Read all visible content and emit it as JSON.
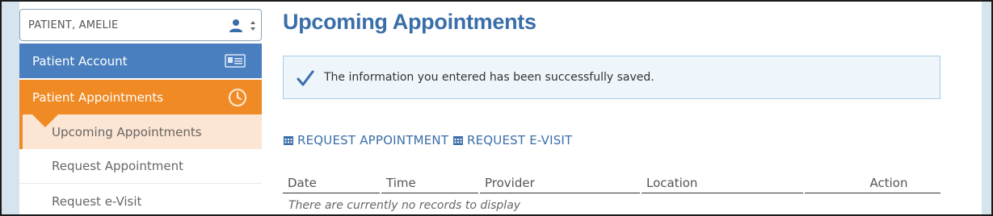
{
  "patient_selector": {
    "name": "PATIENT, AMELIE"
  },
  "sidebar": {
    "account": {
      "label": "Patient Account"
    },
    "appointments": {
      "label": "Patient Appointments"
    },
    "sub_items": [
      {
        "label": "Upcoming Appointments",
        "active": true
      },
      {
        "label": "Request Appointment"
      },
      {
        "label": "Request e-Visit"
      }
    ]
  },
  "main": {
    "title": "Upcoming Appointments",
    "alert": {
      "message": "The information you entered has been successfully saved."
    },
    "actions": [
      {
        "label": "REQUEST APPOINTMENT",
        "icon": "calendar-icon"
      },
      {
        "label": "REQUEST E-VISIT",
        "icon": "calendar-icon"
      }
    ],
    "table": {
      "columns": [
        "Date",
        "Time",
        "Provider",
        "Location",
        "Action"
      ],
      "empty_message": "There are currently no records to display"
    }
  },
  "colors": {
    "blue": "#4a7fbf",
    "orange": "#f08a24",
    "light_orange": "#fce5d3",
    "title_blue": "#3a6ea8",
    "alert_bg": "#eef6fb"
  }
}
